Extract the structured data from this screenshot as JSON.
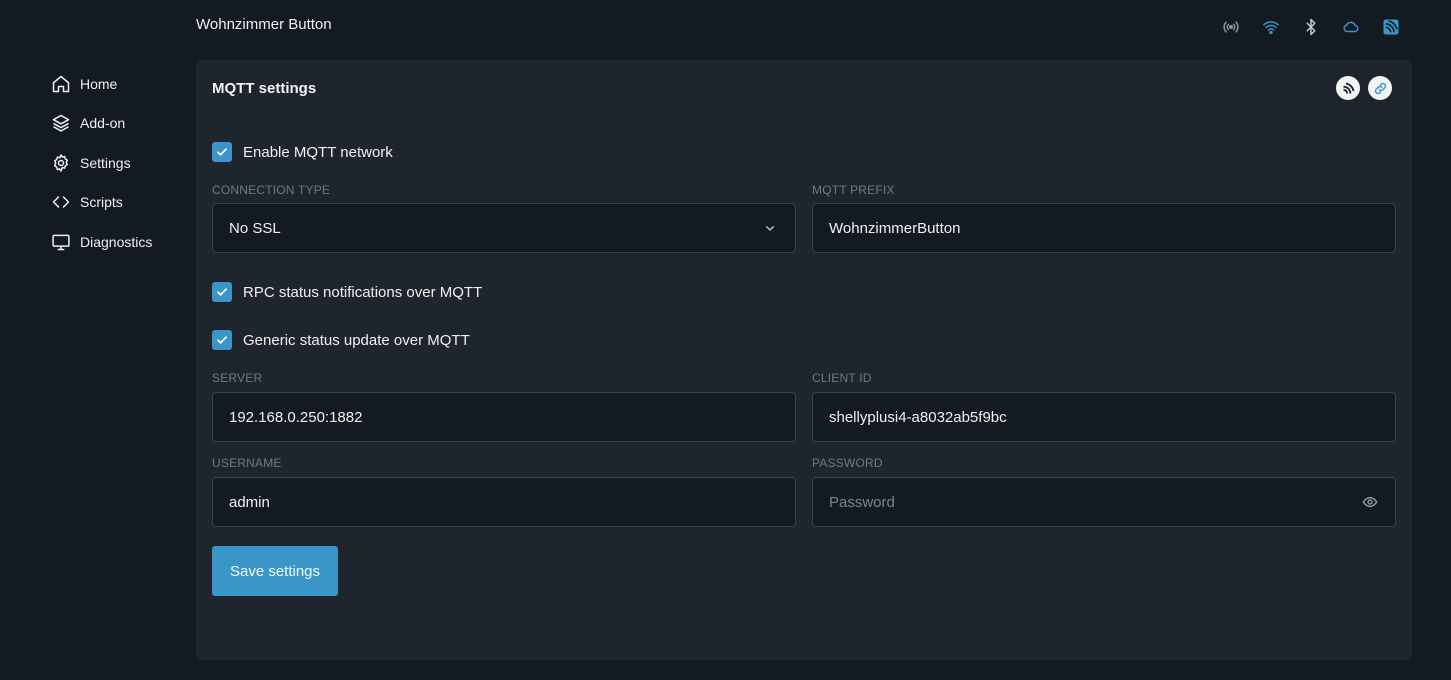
{
  "device": {
    "title": "Wohnzimmer Button"
  },
  "status_icons": [
    {
      "icon": "radio-signal-icon",
      "color": "#8a949e"
    },
    {
      "icon": "wifi-icon",
      "color": "#3a95c9"
    },
    {
      "icon": "bluetooth-icon",
      "color": "#c4c9ce"
    },
    {
      "icon": "cloud-icon",
      "color": "#3a95c9"
    },
    {
      "icon": "mqtt-icon",
      "color": "#3a95c9"
    }
  ],
  "sidebar": {
    "items": [
      {
        "label": "Home",
        "icon": "home-icon"
      },
      {
        "label": "Add-on",
        "icon": "layers-icon"
      },
      {
        "label": "Settings",
        "icon": "gear-icon"
      },
      {
        "label": "Scripts",
        "icon": "code-icon"
      },
      {
        "label": "Diagnostics",
        "icon": "monitor-icon"
      }
    ]
  },
  "card": {
    "title": "MQTT settings",
    "enable_mqtt": {
      "label": "Enable MQTT network",
      "checked": true
    },
    "connection_type": {
      "label": "CONNECTION TYPE",
      "value": "No SSL"
    },
    "mqtt_prefix": {
      "label": "MQTT PREFIX",
      "value": "WohnzimmerButton"
    },
    "rpc_notifications": {
      "label": "RPC status notifications over MQTT",
      "checked": true
    },
    "generic_status": {
      "label": "Generic status update over MQTT",
      "checked": true
    },
    "server": {
      "label": "SERVER",
      "value": "192.168.0.250:1882"
    },
    "client_id": {
      "label": "CLIENT ID",
      "value": "shellyplusi4-a8032ab5f9bc"
    },
    "username": {
      "label": "USERNAME",
      "value": "admin"
    },
    "password": {
      "label": "PASSWORD",
      "placeholder": "Password",
      "value": ""
    },
    "save_label": "Save settings"
  },
  "colors": {
    "background": "#141a21",
    "card": "#1f252d",
    "accent": "#3a95c9"
  }
}
